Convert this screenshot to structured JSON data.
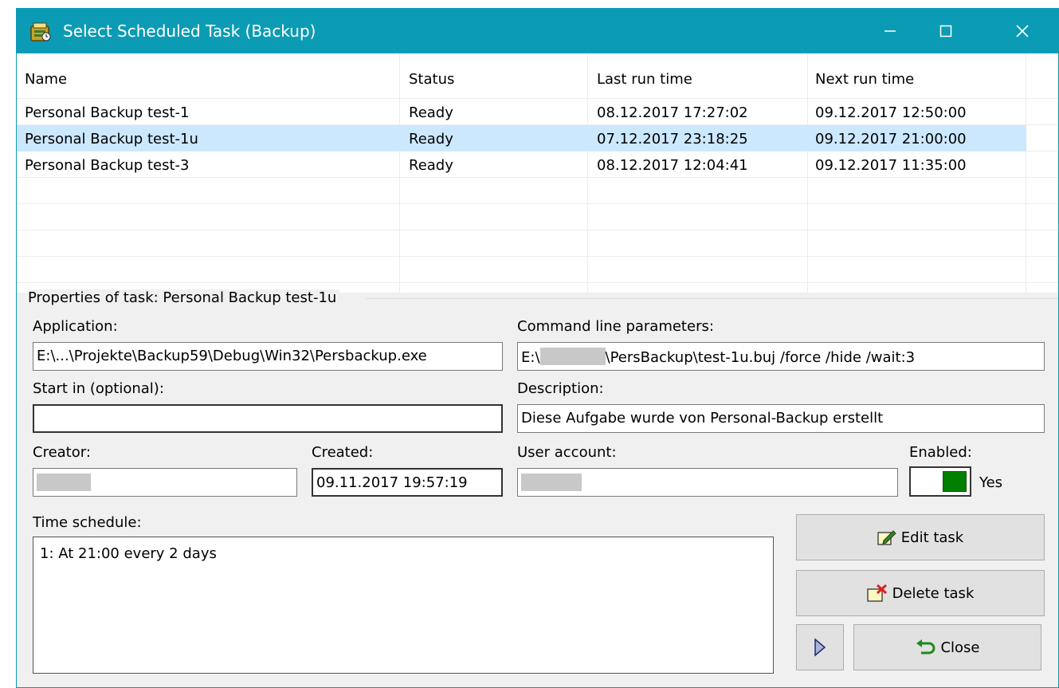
{
  "window": {
    "title": "Select Scheduled Task (Backup)"
  },
  "columns": [
    "Name",
    "Status",
    "Last run time",
    "Next run time"
  ],
  "tasks": [
    {
      "name": "Personal Backup test-1",
      "status": "Ready",
      "last_run": "08.12.2017 17:27:02",
      "next_run": "09.12.2017 12:50:00"
    },
    {
      "name": "Personal Backup test-1u",
      "status": "Ready",
      "last_run": "07.12.2017 23:18:25",
      "next_run": "09.12.2017 21:00:00"
    },
    {
      "name": "Personal Backup test-3",
      "status": "Ready",
      "last_run": "08.12.2017 12:04:41",
      "next_run": "09.12.2017 11:35:00"
    }
  ],
  "selected_row": 1,
  "properties": {
    "group_label": "Properties of task: Personal Backup test-1u",
    "application_label": "Application:",
    "application_value": "E:\\...\\Projekte\\Backup59\\Debug\\Win32\\Persbackup.exe",
    "cmdline_label": "Command line parameters:",
    "cmdline_prefix": "E:\\",
    "cmdline_suffix": "\\PersBackup\\test-1u.buj /force /hide /wait:3",
    "startin_label": "Start in (optional):",
    "startin_value": "",
    "description_label": "Description:",
    "description_value": "Diese Aufgabe wurde von Personal-Backup erstellt",
    "creator_label": "Creator:",
    "created_label": "Created:",
    "created_value": "09.11.2017 19:57:19",
    "user_account_label": "User account:",
    "enabled_label": "Enabled:",
    "enabled_value": "Yes",
    "schedule_label": "Time schedule:",
    "schedule_value": "1: At 21:00 every 2 days"
  },
  "buttons": {
    "edit": "Edit task",
    "delete": "Delete task",
    "close": "Close"
  },
  "colors": {
    "titlebar": "#0c9bb4",
    "selected_row": "#cce8ff",
    "toggle_on": "#008000"
  }
}
